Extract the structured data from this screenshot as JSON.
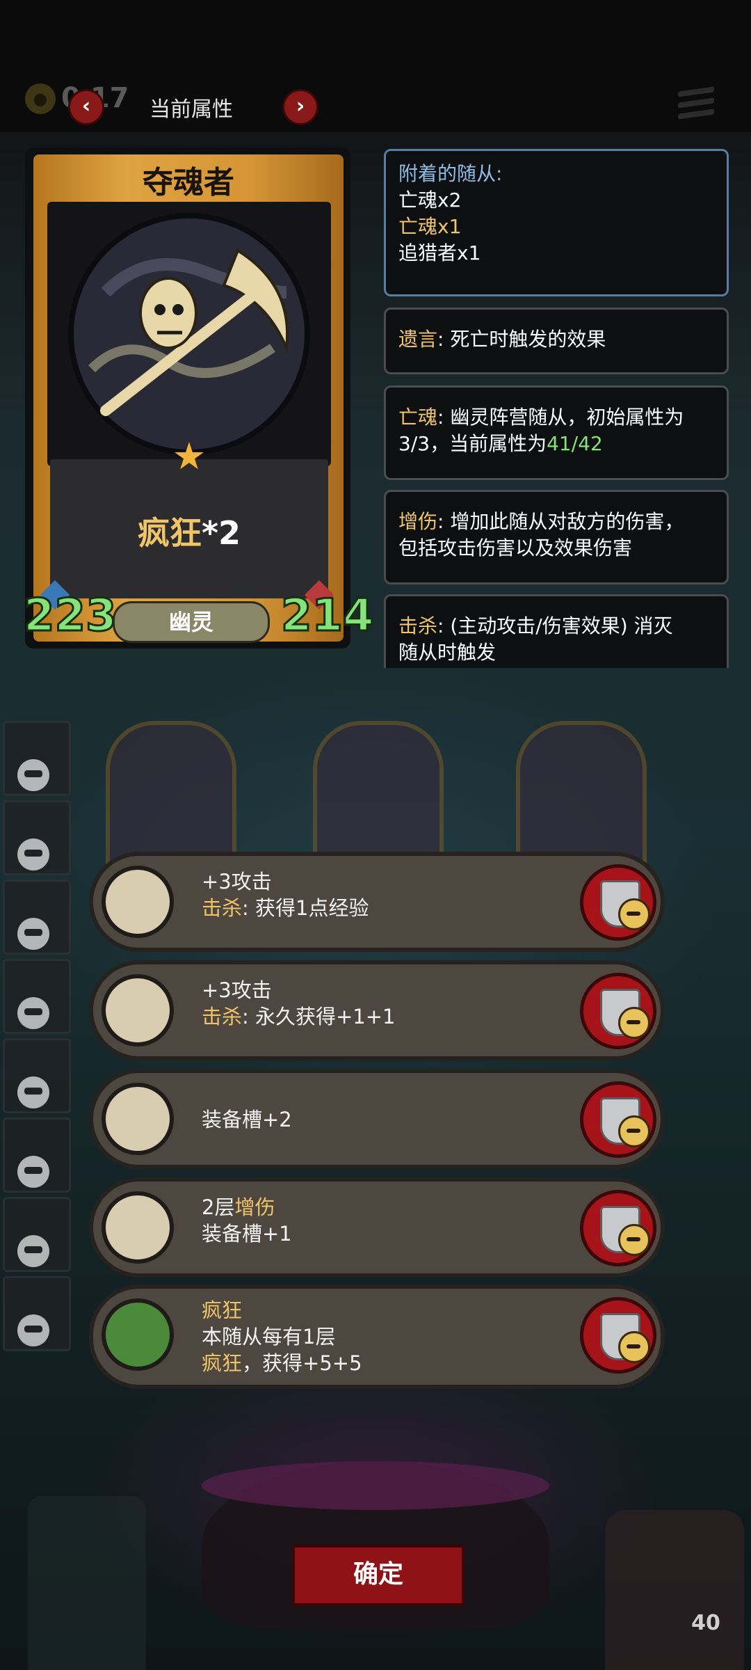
{
  "header": {
    "coin_count": "0 17",
    "title": "当前属性",
    "prev_arrow": "‹",
    "next_arrow": "›"
  },
  "card": {
    "name": "夺魂者",
    "madness_label": "疯狂",
    "madness_count": "*2",
    "tribe": "幽灵",
    "attack": "223",
    "health": "214"
  },
  "info_panels": {
    "attached": {
      "title": "附着的随从:",
      "items": [
        {
          "name": "亡魂",
          "count": "x2"
        },
        {
          "name": "亡魂",
          "count": "x1"
        },
        {
          "name": "追猎者",
          "count": "x1"
        }
      ]
    },
    "deathrattle": {
      "keyword": "遗言",
      "text": ": 死亡时触发的效果"
    },
    "soul": {
      "keyword": "亡魂",
      "text1": ": 幽灵阵营随从，初始属性为",
      "text2": "3/3，当前属性为",
      "value": "41/42"
    },
    "damage_boost": {
      "keyword": "增伤",
      "text1": ": 增加此随从对敌方的伤害，",
      "text2": "包括攻击伤害以及效果伤害"
    },
    "kill": {
      "keyword": "击杀",
      "text1": ": (主动攻击/伤害效果) 消灭",
      "text2": "随从时触发"
    }
  },
  "bonuses": [
    {
      "line1": "+3攻击",
      "keyword": "击杀",
      "line2": ": 获得1点经验"
    },
    {
      "line1": "+3攻击",
      "keyword": "击杀",
      "line2": ": 永久获得+1+1"
    },
    {
      "line1": "装备槽+2"
    },
    {
      "line1_prefix": "2层",
      "line1_keyword": "增伤",
      "line2": "装备槽+1"
    },
    {
      "keyword": "疯狂",
      "line2": "本随从每有1层",
      "line3_keyword": "疯狂",
      "line3": "，获得+5+5"
    }
  ],
  "footer": {
    "confirm": "确定",
    "level": "40"
  },
  "colors": {
    "gold": "#f0c56a",
    "green": "#86e27a",
    "blue_title": "#8fbde8",
    "red_button": "#8e1216"
  }
}
